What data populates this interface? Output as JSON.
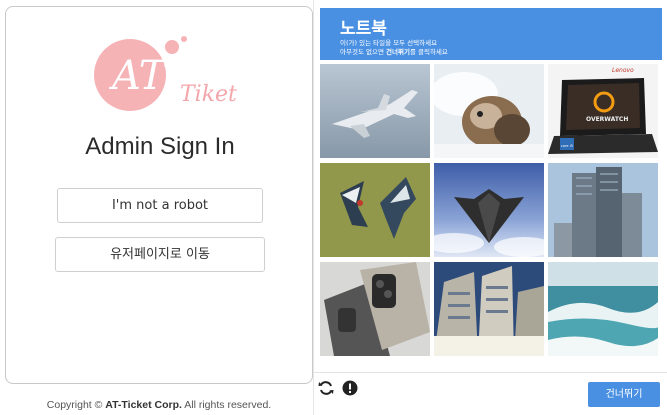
{
  "login": {
    "logo_text_main": "AT",
    "logo_text_sub": "Tiket",
    "title": "Admin Sign In",
    "robot_button": "I'm not a robot",
    "user_page_button": "유저페이지로 이동"
  },
  "footer": {
    "prefix": "Copyright ©",
    "company": "AT-Ticket Corp.",
    "suffix": "All rights reserved."
  },
  "captcha": {
    "word": "노트북",
    "instruction_1": "이(가) 있는 타일을 모두 선택하세요",
    "instruction_2_prefix": "아무것도 없으면",
    "instruction_2_bold": "건너뛰기",
    "instruction_2_suffix": "를 클릭하세요",
    "skip_button": "건너뛰기",
    "tiles": [
      {
        "name": "airplane"
      },
      {
        "name": "dog-in-snow"
      },
      {
        "name": "laptop",
        "brand_text": "Lenovo",
        "screen_text": "OVERWATCH",
        "badge_text": "core i5"
      },
      {
        "name": "birds"
      },
      {
        "name": "stealth-aircraft"
      },
      {
        "name": "skyscraper"
      },
      {
        "name": "smartphone"
      },
      {
        "name": "apartment-buildings"
      },
      {
        "name": "ocean-waves"
      }
    ],
    "colors": {
      "accent": "#4a90e2"
    }
  }
}
